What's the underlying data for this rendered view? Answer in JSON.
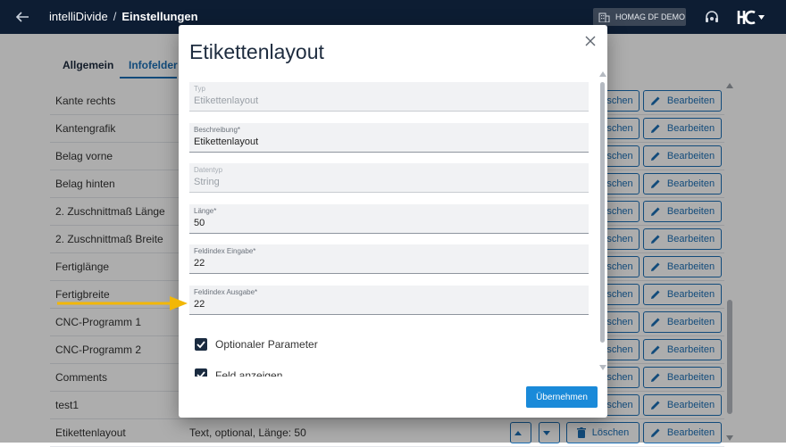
{
  "header": {
    "app_name": "intelliDivide",
    "separator": "/",
    "page": "Einstellungen",
    "tenant": "HOMAG DF DEMO"
  },
  "tabs": [
    {
      "label": "Allgemein",
      "active": false
    },
    {
      "label": "Infofelder",
      "active": true
    }
  ],
  "table": {
    "rows": [
      {
        "name": "Kante rechts",
        "description": ""
      },
      {
        "name": "Kantengrafik",
        "description": ""
      },
      {
        "name": "Belag vorne",
        "description": ""
      },
      {
        "name": "Belag hinten",
        "description": ""
      },
      {
        "name": "2. Zuschnittmaß Länge",
        "description": ""
      },
      {
        "name": "2. Zuschnittmaß Breite",
        "description": ""
      },
      {
        "name": "Fertiglänge",
        "description": ""
      },
      {
        "name": "Fertigbreite",
        "description": ""
      },
      {
        "name": "CNC-Programm 1",
        "description": ""
      },
      {
        "name": "CNC-Programm 2",
        "description": ""
      },
      {
        "name": "Comments",
        "description": ""
      },
      {
        "name": "test1",
        "description": ""
      },
      {
        "name": "Etikettenlayout",
        "description": "Text, optional, Länge: 50"
      }
    ],
    "delete_label": "Löschen",
    "delete_label_partial": "schen",
    "edit_label": "Bearbeiten"
  },
  "dialog": {
    "title": "Etikettenlayout",
    "fields": [
      {
        "label": "Typ",
        "value": "Etikettenlayout",
        "disabled": true
      },
      {
        "label": "Beschreibung*",
        "value": "Etikettenlayout",
        "disabled": false
      },
      {
        "label": "Datentyp",
        "value": "String",
        "disabled": true
      },
      {
        "label": "Länge*",
        "value": "50",
        "disabled": false
      },
      {
        "label": "Feldindex Eingabe*",
        "value": "22",
        "disabled": false
      },
      {
        "label": "Feldindex Ausgabe*",
        "value": "22",
        "disabled": false
      }
    ],
    "checkboxes": [
      {
        "label": "Optionaler Parameter",
        "checked": true
      },
      {
        "label": "Feld anzeigen",
        "checked": true
      }
    ],
    "submit_label": "Übernehmen"
  },
  "colors": {
    "header_bg": "#0d1d33",
    "accent": "#1b6fb6",
    "primary_button": "#1a8ad9",
    "annotation_arrow": "#f2b705"
  }
}
